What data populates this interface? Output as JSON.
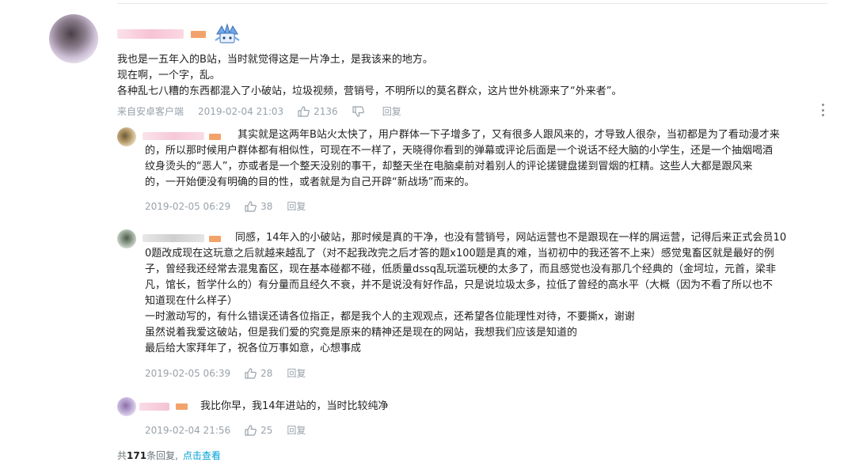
{
  "main": {
    "lines": [
      "我也是一五年入的B站，当时就觉得这是一片净土，是我该来的地方。",
      "现在啊，一个字，乱。",
      "各种乱七八糟的东西都混入了小破站，垃圾视频，营销号，不明所以的莫名群众，这片世外桃源来了“外来者”。"
    ],
    "source": "来自安卓客户端",
    "time": "2019-02-04 21:03",
    "likes": "2136",
    "reply_label": "回复"
  },
  "replies": [
    {
      "lines": [
        "其实就是这两年B站火太快了，用户群体一下子增多了，又有很多人跟风来的，才导致人很杂，当初都是为了看动漫才来",
        "的，所以那时候用户群体都有相似性，可现在不一样了，天晓得你看到的弹幕或评论后面是一个说话不经大脑的小学生，还是一个抽烟喝酒",
        "纹身烫头的“恶人”，亦或者是一个整天没别的事干，却整天坐在电脑桌前对着别人的评论搓键盘搓到冒烟的杠精。这些人大都是跟风来",
        "的，一开始便没有明确的目的性，或者就是为自己开辟“新战场”而来的。"
      ],
      "time": "2019-02-05 06:29",
      "likes": "38",
      "reply_label": "回复"
    },
    {
      "lines": [
        "同感，14年入的小破站，那时候是真的干净，也没有营销号，网站运营也不是跟现在一样的屑运营，记得后来正式会员10",
        "0题改成现在这玩意之后就越来越乱了（对不起我改完之后才答的题x100题是真的难，当初初中的我还答不上来）感觉鬼畜区就是最好的例",
        "子，曾经我还经常去混鬼畜区，现在基本碰都不碰，低质量dssq乱玩滥玩梗的太多了，而且感觉也没有那几个经典的（金坷垃，元首，梁非",
        "凡，馆长，哲学什么的）有分量而且经久不衰，并不是说没有好作品，只是说垃圾太多，拉低了曾经的高水平（大概（因为不看了所以也不",
        "知道现在什么样子）",
        "一时激动写的，有什么错误还请各位指正，都是我个人的主观观点，还希望各位能理性对待，不要撕x，谢谢",
        "虽然说着我爱这破站，但是我们爱的究竟是原来的精神还是现在的网站，我想我们应该是知道的",
        "最后给大家拜年了，祝各位万事如意，心想事成"
      ],
      "time": "2019-02-05 06:39",
      "likes": "28",
      "reply_label": "回复"
    },
    {
      "lines": [
        "我比你早，我14年进站的，当时比较纯净"
      ],
      "time": "2019-02-04 21:56",
      "likes": "25",
      "reply_label": "回复"
    }
  ],
  "footer": {
    "prefix": "共",
    "count": "171",
    "suffix": "条回复,",
    "link": "点击查看"
  },
  "colors": {
    "meta": "#99a2aa",
    "link": "#00a1d6",
    "level_badge": "#f2a36b"
  },
  "icons": {
    "like": "thumbs-up-icon",
    "dislike": "thumbs-down-icon",
    "more": "more-vertical-icon"
  }
}
